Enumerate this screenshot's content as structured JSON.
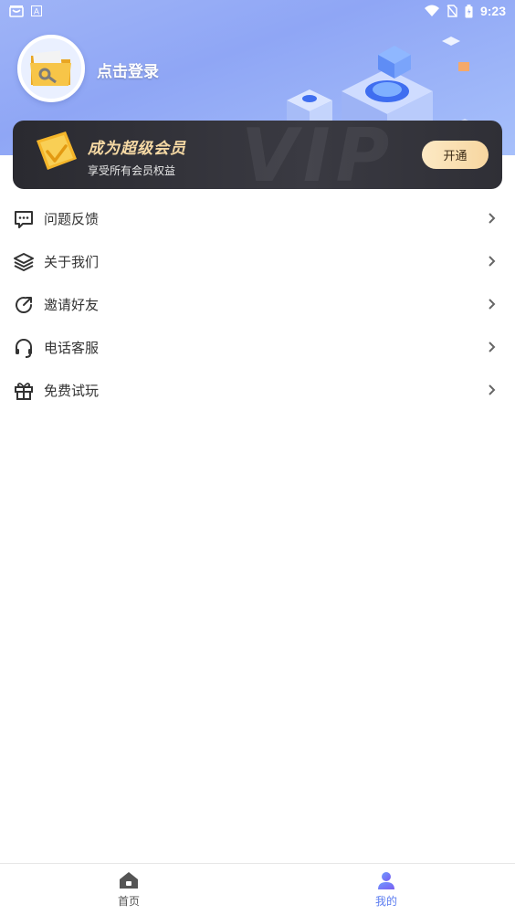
{
  "status_bar": {
    "time": "9:23",
    "left_icons": [
      "shop-icon",
      "a-text-icon"
    ],
    "right_icons": [
      "wifi-icon",
      "no-sim-icon",
      "battery-icon"
    ]
  },
  "profile": {
    "login_text": "点击登录",
    "avatar_icon": "folder-key-icon"
  },
  "vip": {
    "title": "成为超级会员",
    "subtitle": "享受所有会员权益",
    "button": "开通",
    "watermark": "VIP"
  },
  "menu": {
    "items": [
      {
        "label": "问题反馈",
        "icon": "feedback-icon"
      },
      {
        "label": "关于我们",
        "icon": "layers-icon"
      },
      {
        "label": "邀请好友",
        "icon": "share-icon"
      },
      {
        "label": "电话客服",
        "icon": "headset-icon"
      },
      {
        "label": "免费试玩",
        "icon": "gift-icon"
      }
    ]
  },
  "tabbar": {
    "tabs": [
      {
        "label": "首页",
        "icon": "home-icon",
        "active": false
      },
      {
        "label": "我的",
        "icon": "user-icon",
        "active": true
      }
    ]
  },
  "colors": {
    "header_gradient_start": "#9fb4f7",
    "accent": "#5b7cf0",
    "vip_gold": "#f6d9a4",
    "vip_card_bg": "#2f2f36"
  }
}
